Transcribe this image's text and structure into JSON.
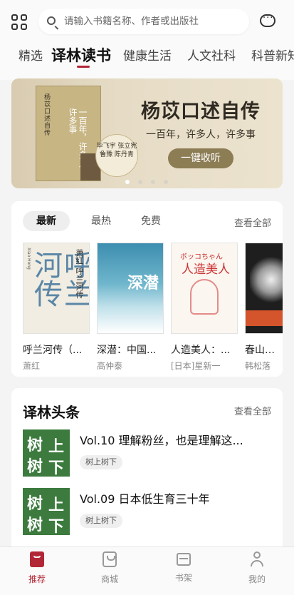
{
  "header": {
    "search_placeholder": "请输入书籍名称、作者或出版社"
  },
  "tabs": [
    "精选",
    "译林读书",
    "健康生活",
    "人文社科",
    "科普新知"
  ],
  "active_tab": "译林读书",
  "banner": {
    "title": "杨苡口述自传",
    "subtitle": "一百年，许多人，许多事",
    "button": "一键收听",
    "book_title": "一百年，许多人，许多事",
    "book_series": "杨苡口述自传",
    "seal_text": "毕飞宇 张立宪 鲁豫 陈丹青",
    "dots_total": 4,
    "dots_active": 0
  },
  "books_section": {
    "subtabs": [
      "最新",
      "最热",
      "免费"
    ],
    "active_subtab": "最新",
    "see_all": "查看全部",
    "books": [
      {
        "title": "呼兰河传（...",
        "author": "萧红",
        "cover_text": "呼兰河传",
        "cover_author": "萧红 呼兰河传",
        "cover_small": "Xiao Hong"
      },
      {
        "title": "深潜：中国...",
        "author": "高仲泰",
        "cover_text": "深潜"
      },
      {
        "title": "人造美人：...",
        "author": "[日本]星新一",
        "cover_jp": "ボッコちゃん",
        "cover_text": "人造美人"
      },
      {
        "title": "春山夜行",
        "author": "韩松落"
      }
    ]
  },
  "news_section": {
    "title": "译林头条",
    "see_all": "查看全部",
    "items": [
      {
        "title": "Vol.10 理解粉丝，也是理解这...",
        "tag": "树上树下",
        "thumb": [
          "树",
          "上",
          "树",
          "下"
        ]
      },
      {
        "title": "Vol.09 日本低生育三十年",
        "tag": "树上树下",
        "thumb": [
          "树",
          "上",
          "树",
          "下"
        ]
      }
    ]
  },
  "bottom_nav": [
    {
      "label": "推荐",
      "icon": "bookmark-icon",
      "active": true
    },
    {
      "label": "商城",
      "icon": "shop-bag-icon",
      "active": false
    },
    {
      "label": "书架",
      "icon": "bookshelf-icon",
      "active": false
    },
    {
      "label": "我的",
      "icon": "user-icon",
      "active": false
    }
  ],
  "colors": {
    "accent": "#b22735",
    "banner_bg": "#e6dcc6",
    "news_thumb": "#3c7a3e"
  }
}
